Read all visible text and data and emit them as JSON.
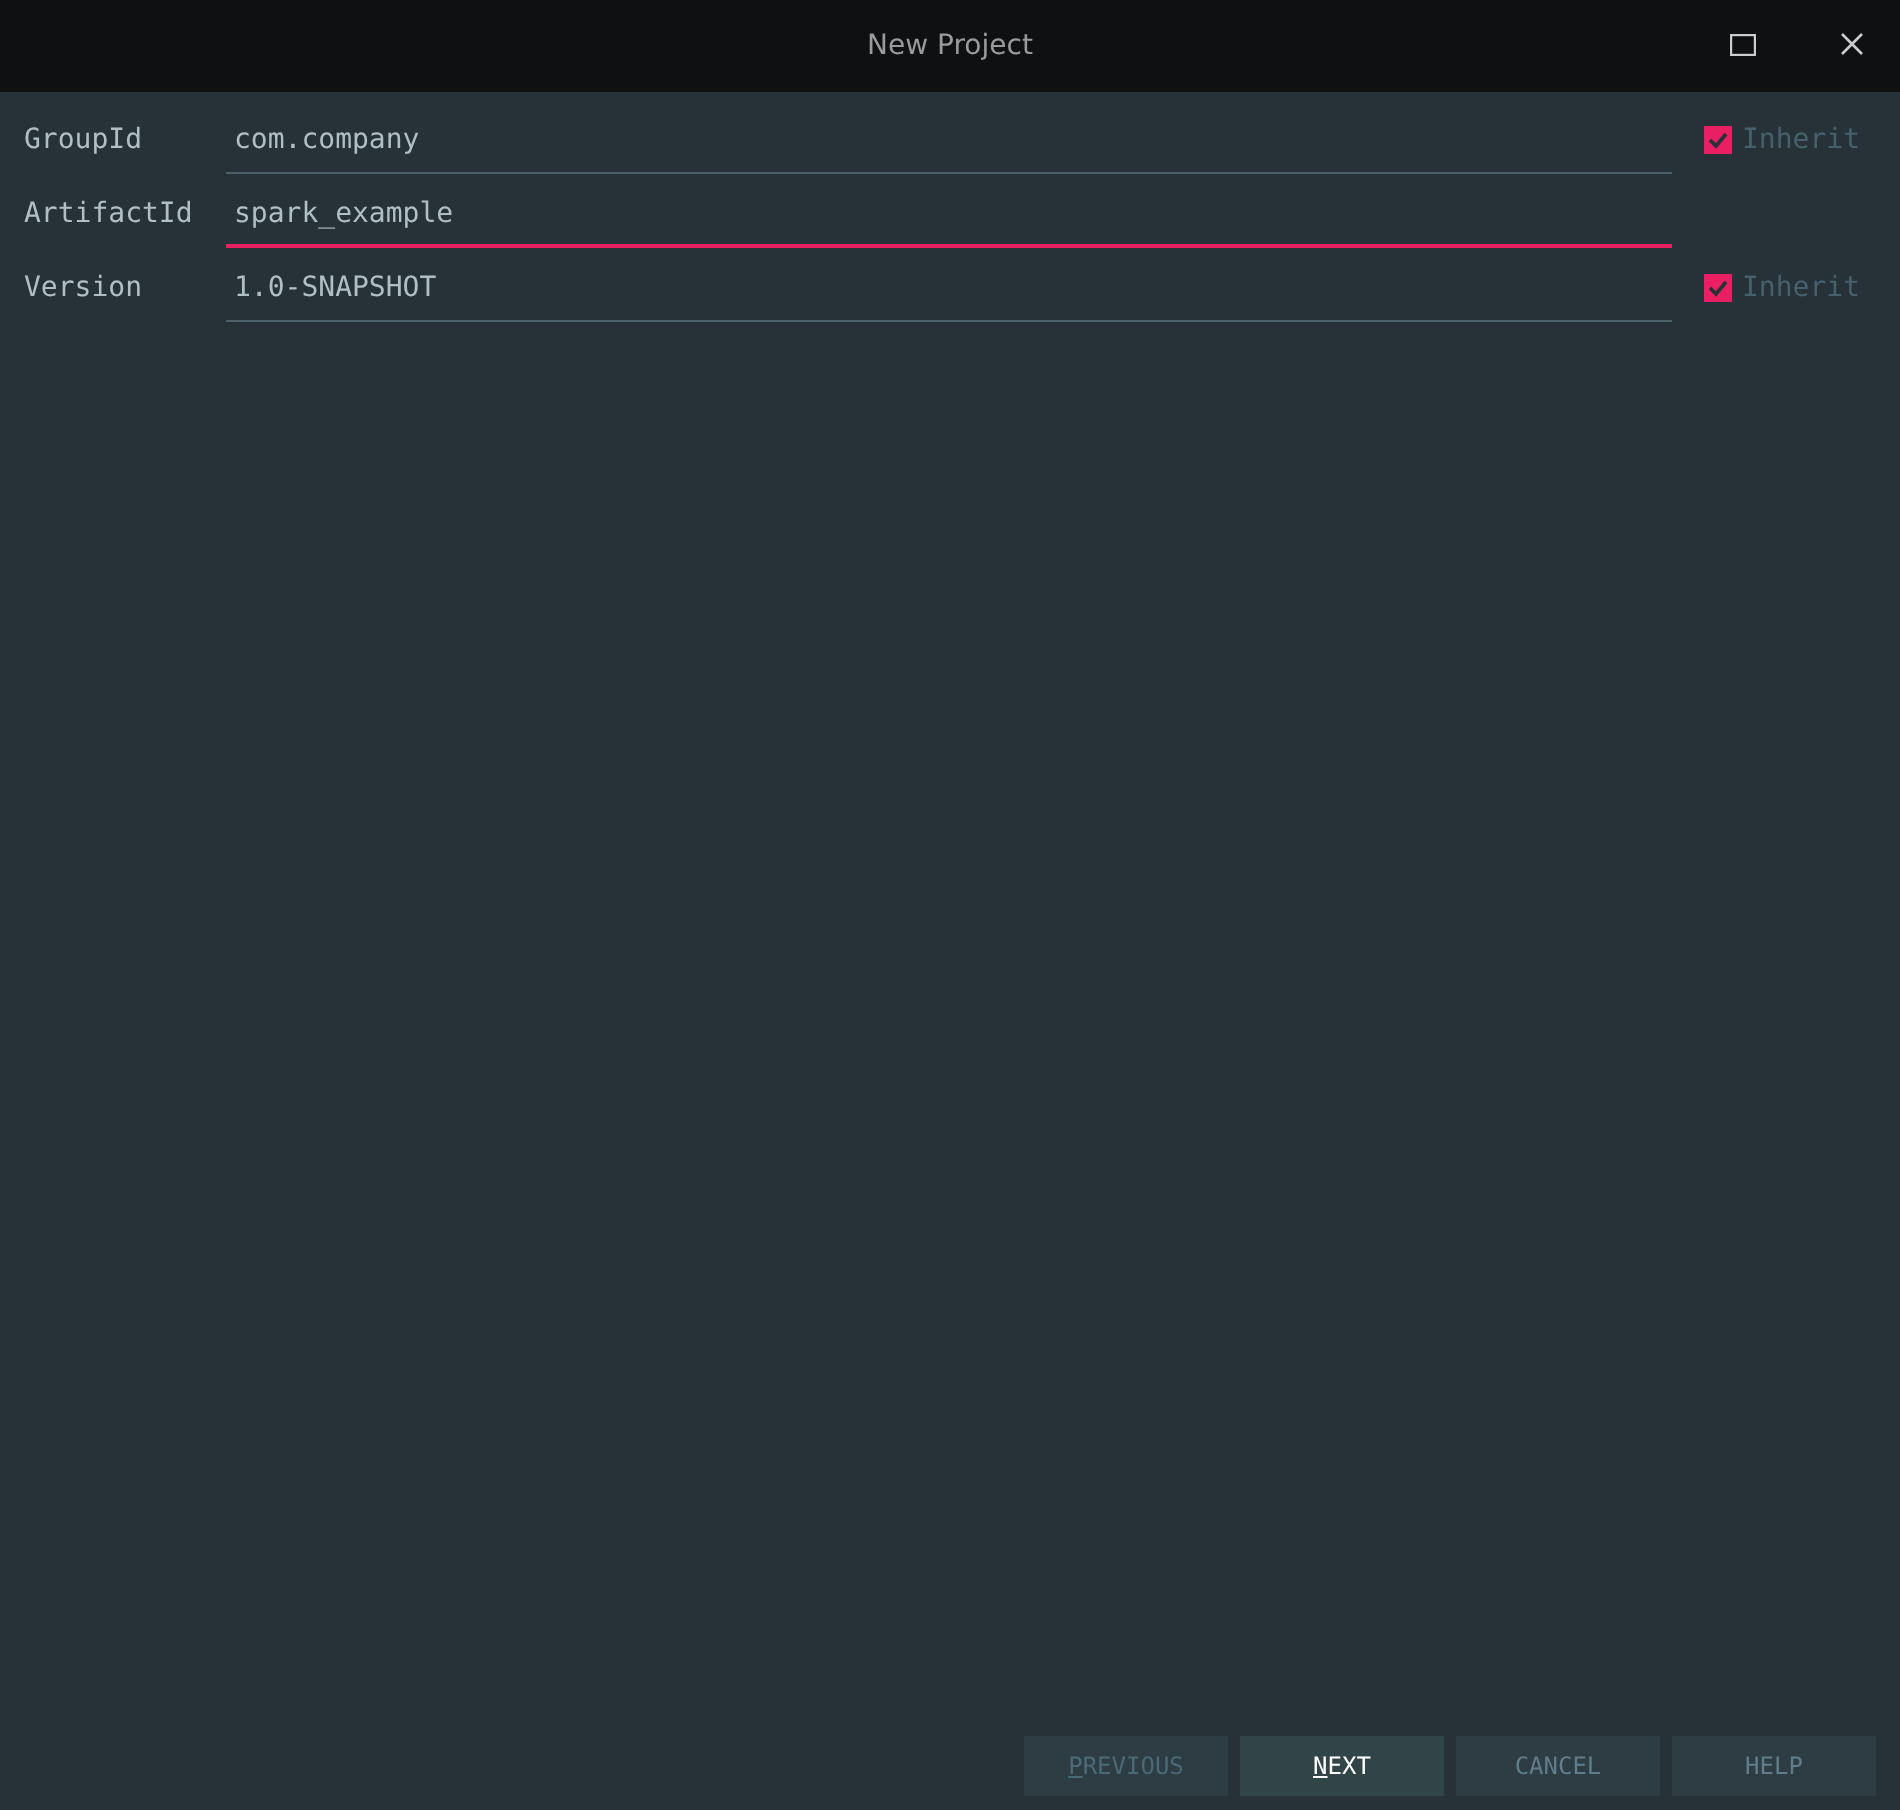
{
  "window": {
    "title": "New Project"
  },
  "fields": [
    {
      "label": "GroupId",
      "value": "com.company",
      "focused": false,
      "inherit": {
        "label": "Inherit",
        "checked": true,
        "disabled": true
      }
    },
    {
      "label": "ArtifactId",
      "value": "spark_example",
      "focused": true
    },
    {
      "label": "Version",
      "value": "1.0-SNAPSHOT",
      "focused": false,
      "inherit": {
        "label": "Inherit",
        "checked": true,
        "disabled": true
      }
    }
  ],
  "buttons": [
    {
      "label": "PREVIOUS",
      "disabled": true,
      "default": false,
      "mnemonic_first": true
    },
    {
      "label": "NEXT",
      "disabled": false,
      "default": true,
      "mnemonic_first": true
    },
    {
      "label": "CANCEL",
      "disabled": false,
      "default": false,
      "mnemonic_first": false
    },
    {
      "label": "HELP",
      "disabled": false,
      "default": false,
      "mnemonic_first": false
    }
  ]
}
